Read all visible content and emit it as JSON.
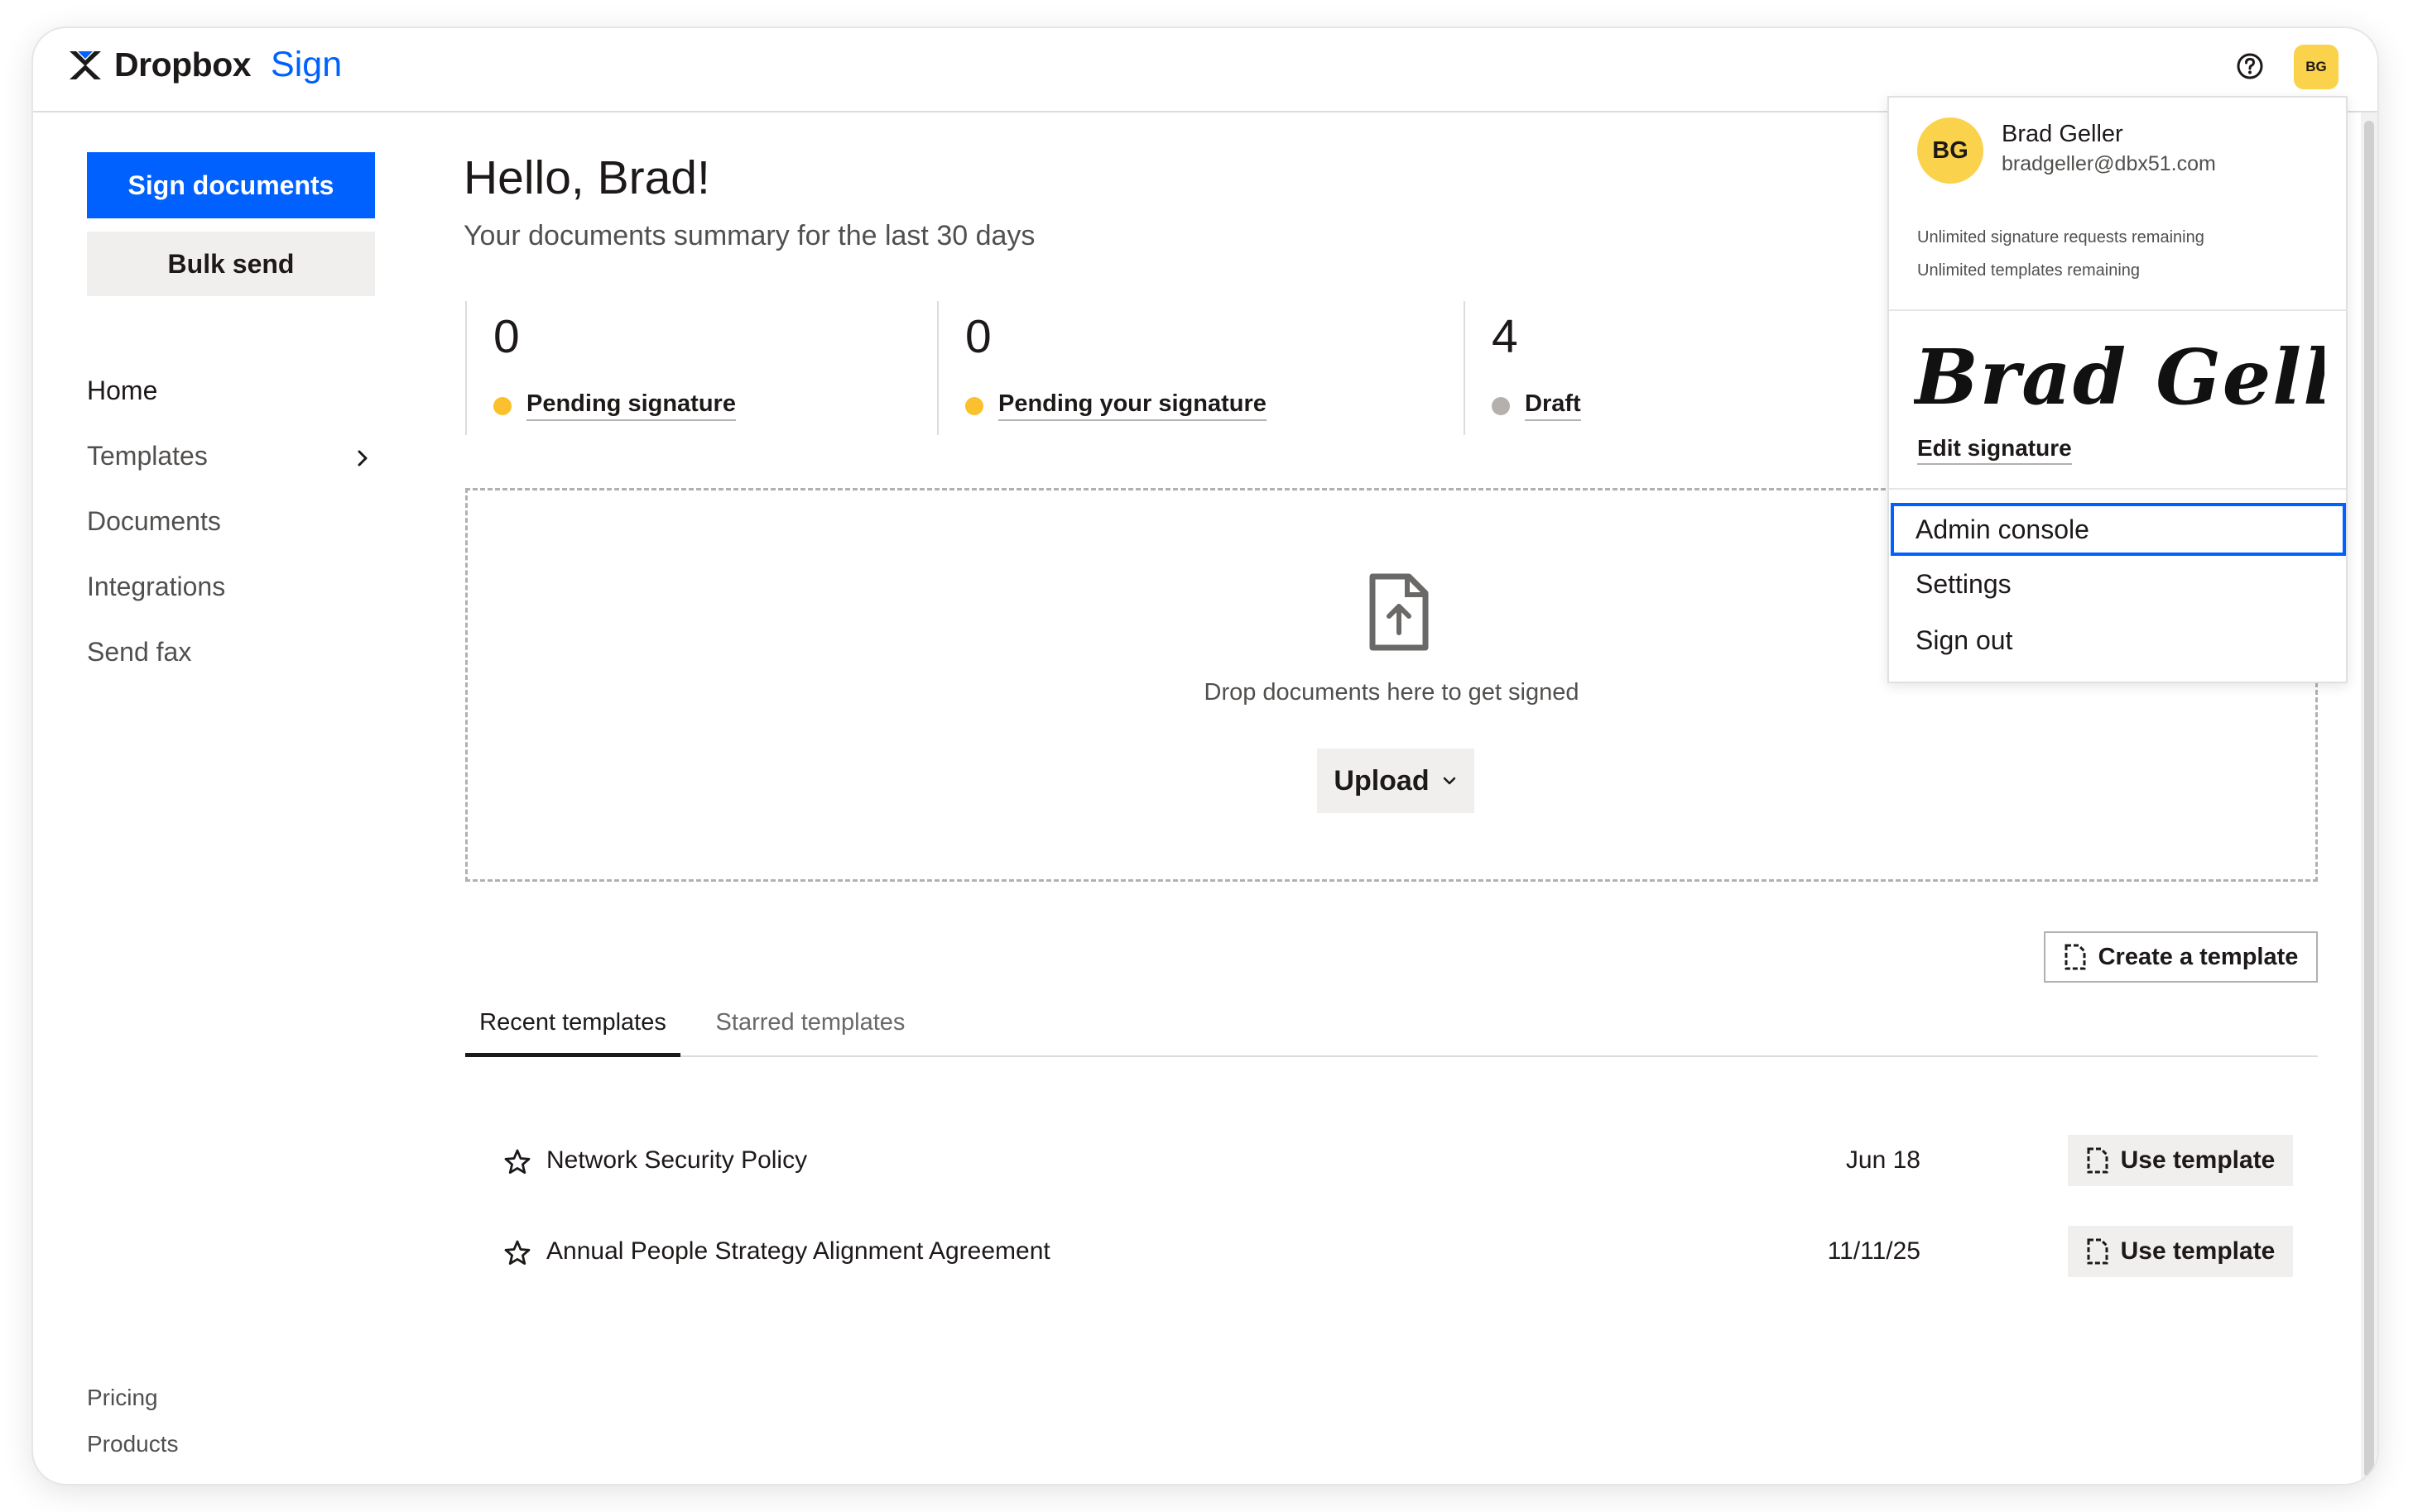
{
  "brand": {
    "name": "Dropbox",
    "product": "Sign"
  },
  "header": {
    "avatar_initials": "BG"
  },
  "sidebar": {
    "primary_button": "Sign documents",
    "secondary_button": "Bulk send",
    "nav": [
      "Home",
      "Templates",
      "Documents",
      "Integrations",
      "Send fax"
    ],
    "footer_links": [
      "Pricing",
      "Products"
    ]
  },
  "main": {
    "greeting": "Hello, Brad!",
    "subtitle": "Your documents summary for the last 30 days",
    "stats": [
      {
        "value": "0",
        "label": "Pending signature",
        "color": "#fbc02d"
      },
      {
        "value": "0",
        "label": "Pending your signature",
        "color": "#fbc02d"
      },
      {
        "value": "4",
        "label": "Draft",
        "color": "#b4b0ad"
      }
    ],
    "dropzone": {
      "text": "Drop documents here to get signed",
      "upload_label": "Upload"
    },
    "create_template_label": "Create a template",
    "tabs": [
      "Recent templates",
      "Starred templates"
    ],
    "templates": [
      {
        "name": "Network Security Policy",
        "date": "Jun 18",
        "action": "Use template"
      },
      {
        "name": "Annual People Strategy Alignment Agreement",
        "date": "11/11/25",
        "action": "Use template"
      }
    ]
  },
  "account_menu": {
    "initials": "BG",
    "name": "Brad Geller",
    "email": "bradgeller@dbx51.com",
    "quota_requests": "Unlimited signature requests remaining",
    "quota_templates": "Unlimited templates remaining",
    "signature_image_text": "Brad Geller",
    "edit_signature": "Edit signature",
    "items": [
      "Admin console",
      "Settings",
      "Sign out"
    ]
  },
  "colors": {
    "accent": "#0061fe",
    "avatar": "#fad24b"
  }
}
